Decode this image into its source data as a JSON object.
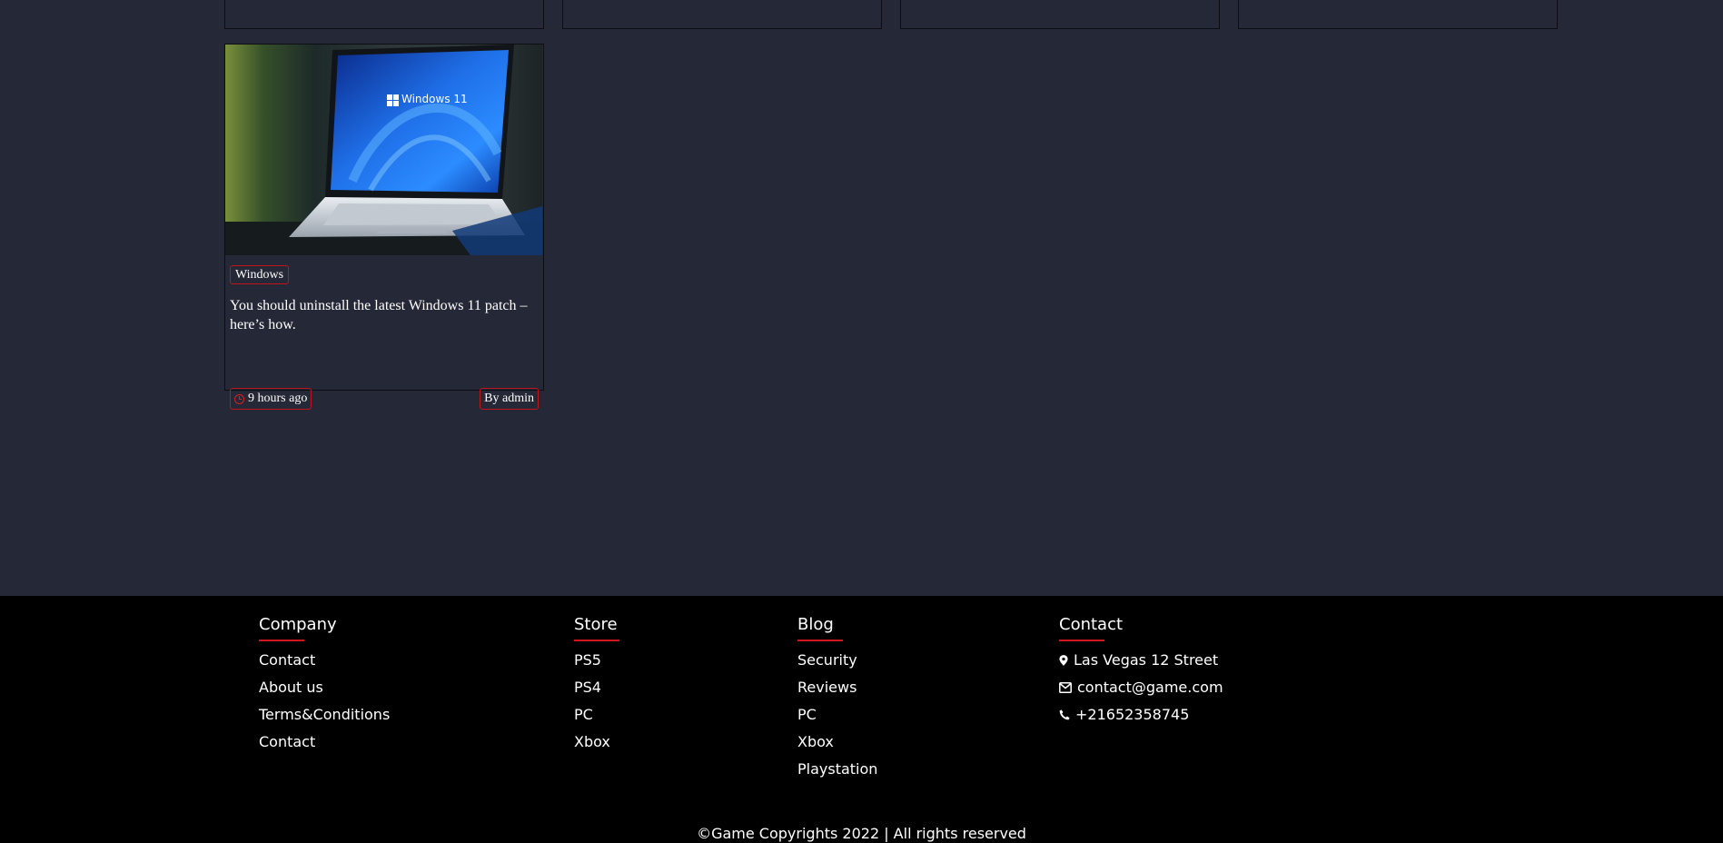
{
  "post": {
    "category": "Windows",
    "title": "You should uninstall the latest Windows 11 patch – here’s how.",
    "time": "9 hours ago",
    "author": "By admin",
    "image_text": "Windows 11"
  },
  "footer": {
    "company": {
      "heading": "Company",
      "links": [
        "Contact",
        "About us",
        "Terms&Conditions",
        "Contact"
      ]
    },
    "store": {
      "heading": "Store",
      "links": [
        "PS5",
        "PS4",
        "PC",
        "Xbox"
      ]
    },
    "blog": {
      "heading": "Blog",
      "links": [
        "Security",
        "Reviews",
        "PC",
        "Xbox",
        "Playstation"
      ]
    },
    "contact": {
      "heading": "Contact",
      "address": "Las Vegas 12 Street",
      "email": "contact@game.com",
      "phone": "+21652358745"
    },
    "copyright": "©Game Copyrights 2022 | All rights reserved"
  },
  "colors": {
    "page_bg": "#252836",
    "accent": "#d0151e",
    "footer_bg": "#000000"
  },
  "icons": [
    "clock-icon",
    "map-marker-icon",
    "envelope-icon",
    "phone-icon"
  ]
}
